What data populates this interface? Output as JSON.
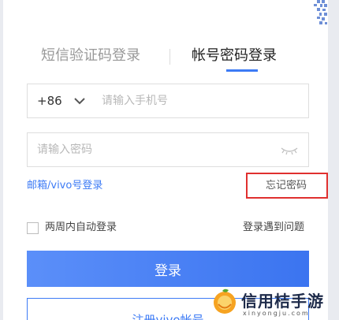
{
  "tabs": {
    "sms": "短信验证码登录",
    "account": "帐号密码登录",
    "active": "account"
  },
  "phone": {
    "country_code": "+86",
    "placeholder": "请输入手机号",
    "value": ""
  },
  "password": {
    "placeholder": "请输入密码",
    "value": ""
  },
  "links": {
    "email_vivo_login": "邮箱/vivo号登录",
    "forgot_password": "忘记密码",
    "login_problem": "登录遇到问题"
  },
  "auto_login": {
    "label": "两周内自动登录",
    "checked": false
  },
  "buttons": {
    "login": "登录",
    "register": "注册vivo帐号"
  },
  "watermark": {
    "title": "信用桔手游",
    "domain": "xinyongju.com"
  },
  "colors": {
    "accent": "#3d7bf5",
    "highlight_border": "#e0302f"
  },
  "icons": {
    "country_dropdown": "chevron-down-icon",
    "password_visibility": "eye-closed-icon",
    "qr_code": "qr-code-icon"
  }
}
